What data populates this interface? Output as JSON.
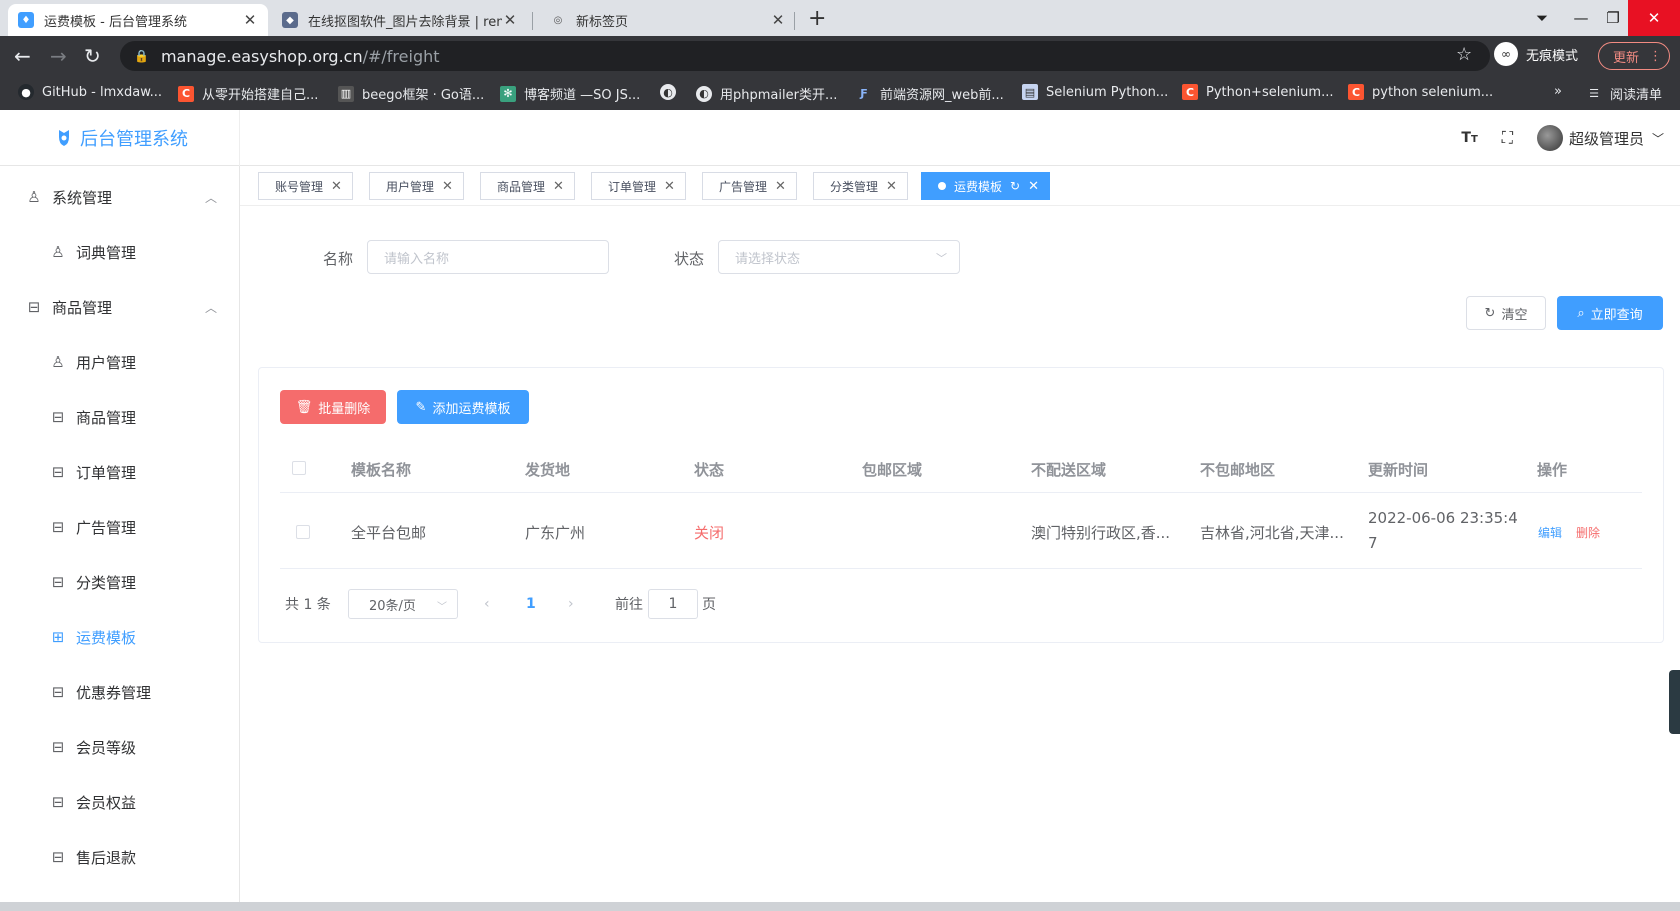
{
  "browser": {
    "tabs": [
      {
        "title": "运费模板 - 后台管理系统",
        "active": true
      },
      {
        "title": "在线抠图软件_图片去除背景 | rem",
        "active": false
      },
      {
        "title": "新标签页",
        "active": false
      }
    ],
    "url_host": "manage.easyshop.org.cn",
    "url_path": "/#/freight",
    "incognito_label": "无痕模式",
    "update_label": "更新",
    "bookmarks": [
      "GitHub - lmxdaw...",
      "从零开始搭建自己...",
      "beego框架 · Go语...",
      "博客频道 —SO JS...",
      "",
      "用phpmailer类开...",
      "前端资源网_web前...",
      "Selenium Python...",
      "Python+selenium...",
      "python selenium..."
    ],
    "reading_list": "阅读清单",
    "more": "»"
  },
  "app": {
    "title": "后台管理系统",
    "user_name": "超级管理员",
    "accent": "#409eff"
  },
  "sidebar": {
    "items": [
      {
        "label": "系统管理",
        "type": "group",
        "icon": "user-icon"
      },
      {
        "label": "词典管理",
        "type": "sub",
        "icon": "user-icon"
      },
      {
        "label": "商品管理",
        "type": "group",
        "icon": "box-icon"
      },
      {
        "label": "用户管理",
        "type": "sub",
        "icon": "user-icon"
      },
      {
        "label": "商品管理",
        "type": "sub",
        "icon": "box-icon"
      },
      {
        "label": "订单管理",
        "type": "sub",
        "icon": "box-icon"
      },
      {
        "label": "广告管理",
        "type": "sub",
        "icon": "box-icon"
      },
      {
        "label": "分类管理",
        "type": "sub",
        "icon": "box-icon"
      },
      {
        "label": "运费模板",
        "type": "sub",
        "icon": "grid-icon",
        "active": true
      },
      {
        "label": "优惠券管理",
        "type": "sub",
        "icon": "box-icon"
      },
      {
        "label": "会员等级",
        "type": "sub",
        "icon": "box-icon"
      },
      {
        "label": "会员权益",
        "type": "sub",
        "icon": "box-icon"
      },
      {
        "label": "售后退款",
        "type": "sub",
        "icon": "box-icon"
      }
    ]
  },
  "tags": [
    {
      "label": "账号管理"
    },
    {
      "label": "用户管理"
    },
    {
      "label": "商品管理"
    },
    {
      "label": "订单管理"
    },
    {
      "label": "广告管理"
    },
    {
      "label": "分类管理"
    },
    {
      "label": "运费模板",
      "active": true
    }
  ],
  "filter": {
    "name_label": "名称",
    "name_placeholder": "请输入名称",
    "status_label": "状态",
    "status_placeholder": "请选择状态",
    "clear_label": "清空",
    "search_label": "立即查询"
  },
  "actions": {
    "batch_delete": "批量删除",
    "add_template": "添加运费模板"
  },
  "table": {
    "columns": [
      "模板名称",
      "发货地",
      "状态",
      "包邮区域",
      "不配送区域",
      "不包邮地区",
      "更新时间",
      "操作"
    ],
    "rows": [
      {
        "name": "全平台包邮",
        "origin": "广东广州",
        "status": "关闭",
        "free_area": "",
        "no_delivery": "澳门特别行政区,香...",
        "no_free": "吉林省,河北省,天津...",
        "updated_line1": "2022-06-06 23:35:4",
        "updated_line2": "7",
        "edit": "编辑",
        "delete": "删除"
      }
    ],
    "status_color": "#f56c6c"
  },
  "pagination": {
    "total": "共 1 条",
    "page_size": "20条/页",
    "current": "1",
    "goto_prefix": "前往",
    "goto_value": "1",
    "goto_suffix": "页"
  }
}
